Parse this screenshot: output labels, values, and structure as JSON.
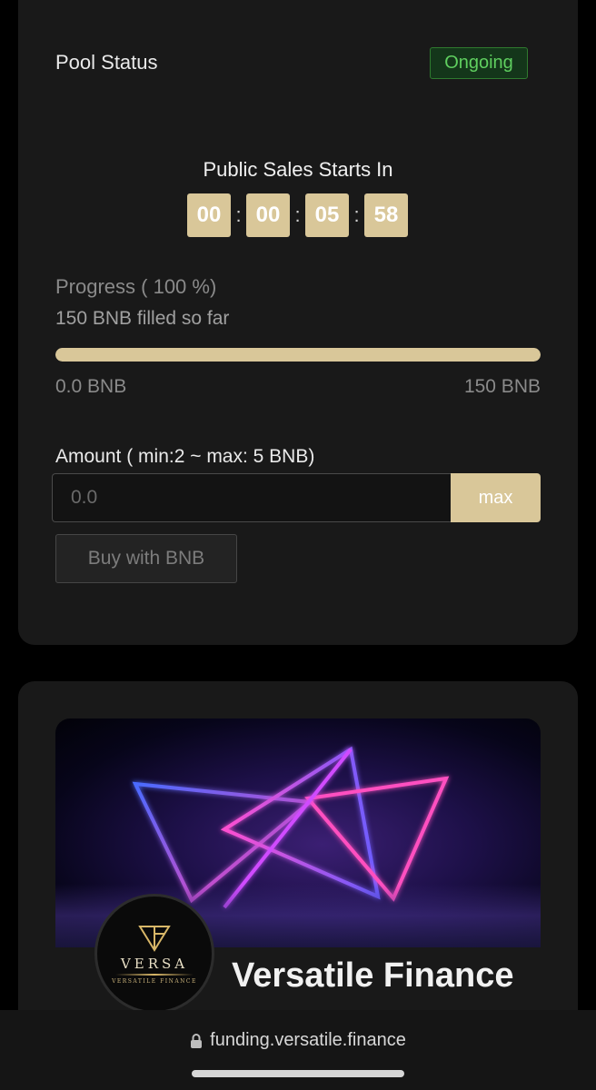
{
  "pool": {
    "status_label": "Pool Status",
    "status_badge": "Ongoing",
    "countdown_title": "Public Sales Starts In",
    "countdown": [
      "00",
      "00",
      "05",
      "58"
    ],
    "countdown_sep": ":",
    "progress_label": "Progress ( 100 %)",
    "progress_fraction": 1.0,
    "filled_label": "150 BNB filled so far",
    "range_min": "0.0 BNB",
    "range_max": "150 BNB",
    "amount_label": "Amount ( min:2 ~ max: 5 BNB)",
    "amount_placeholder": "0.0",
    "max_label": "max",
    "buy_label": "Buy with BNB"
  },
  "project": {
    "name": "Versatile Finance",
    "logo_word": "VERSA",
    "logo_sub": "VERSATILE FINANCE"
  },
  "browser": {
    "url": "funding.versatile.finance"
  },
  "colors": {
    "accent": "#d9c799",
    "status_green": "#5fcf5f",
    "card_bg": "#191919",
    "neon_pink": "#ff3fb4",
    "neon_blue": "#4a6bff"
  }
}
